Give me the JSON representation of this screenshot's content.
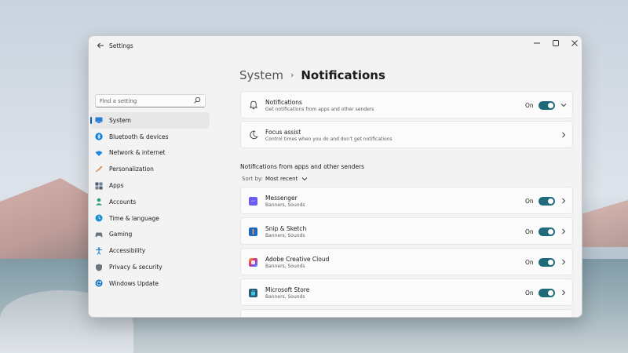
{
  "window": {
    "title": "Settings",
    "controls": {
      "minimize": "—",
      "maximize": "☐",
      "close": "✕"
    }
  },
  "search": {
    "placeholder": "Find a setting"
  },
  "sidebar": {
    "items": [
      {
        "label": "System",
        "icon": "monitor-icon",
        "color": "#2b7cd3",
        "selected": true
      },
      {
        "label": "Bluetooth & devices",
        "icon": "bluetooth-icon",
        "color": "#0a7fd8"
      },
      {
        "label": "Network & internet",
        "icon": "wifi-icon",
        "color": "#1e88e5"
      },
      {
        "label": "Personalization",
        "icon": "brush-icon",
        "color": "#e07b39"
      },
      {
        "label": "Apps",
        "icon": "apps-icon",
        "color": "#4a5b6b"
      },
      {
        "label": "Accounts",
        "icon": "person-icon",
        "color": "#2ea26f"
      },
      {
        "label": "Time & language",
        "icon": "globe-clock-icon",
        "color": "#1c8fd1"
      },
      {
        "label": "Gaming",
        "icon": "controller-icon",
        "color": "#6b7480"
      },
      {
        "label": "Accessibility",
        "icon": "accessibility-icon",
        "color": "#1479c9"
      },
      {
        "label": "Privacy & security",
        "icon": "shield-icon",
        "color": "#6b7480"
      },
      {
        "label": "Windows Update",
        "icon": "update-icon",
        "color": "#1479c9"
      }
    ]
  },
  "breadcrumb": {
    "parent": "System",
    "separator": "›",
    "current": "Notifications"
  },
  "notifications_card": {
    "title": "Notifications",
    "subtitle": "Get notifications from apps and other senders",
    "toggle_label": "On",
    "toggle_on": true
  },
  "focus_card": {
    "title": "Focus assist",
    "subtitle": "Control times when you do and don't get notifications"
  },
  "apps_section": {
    "title": "Notifications from apps and other senders",
    "sort_label": "Sort by:",
    "sort_value": "Most recent",
    "apps": [
      {
        "name": "Messenger",
        "detail": "Banners, Sounds",
        "toggle_label": "On",
        "toggle_on": true,
        "icon": "messenger-icon",
        "color": "#7a4cf0"
      },
      {
        "name": "Snip & Sketch",
        "detail": "Banners, Sounds",
        "toggle_label": "On",
        "toggle_on": true,
        "icon": "snip-sketch-icon",
        "color": "#1d64c8"
      },
      {
        "name": "Adobe Creative Cloud",
        "detail": "Banners, Sounds",
        "toggle_label": "On",
        "toggle_on": true,
        "icon": "creative-cloud-icon",
        "color": "#e83b5c"
      },
      {
        "name": "Microsoft Store",
        "detail": "Banners, Sounds",
        "toggle_label": "On",
        "toggle_on": true,
        "icon": "store-icon",
        "color": "#2b5c74"
      }
    ]
  },
  "colors": {
    "accent": "#005fb8",
    "toggle_on": "#1f6b7a"
  }
}
